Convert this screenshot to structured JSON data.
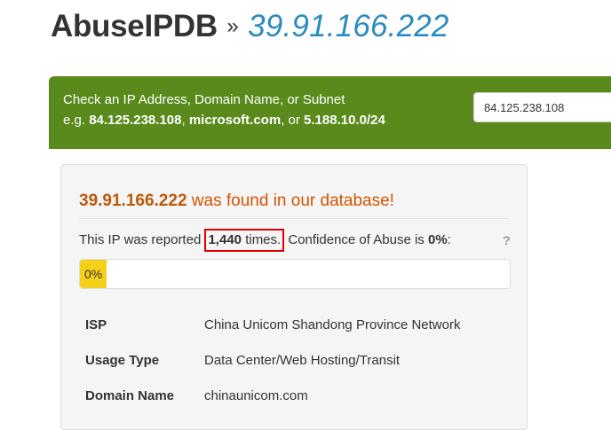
{
  "header": {
    "brand": "AbuseIPDB",
    "separator": "»",
    "ip": "39.91.166.222"
  },
  "search": {
    "prompt": "Check an IP Address, Domain Name, or Subnet",
    "example_prefix": "e.g.",
    "example_ip": "84.125.238.108",
    "example_comma1": ",",
    "example_domain": "microsoft.com",
    "example_or": ", or",
    "example_subnet": "5.188.10.0/24",
    "input_value": "84.125.238.108"
  },
  "result": {
    "ip": "39.91.166.222",
    "found_text": "was found in our database!",
    "report_prefix": "This IP was reported",
    "report_count": "1,440",
    "report_times": "times.",
    "confidence_label": "Confidence of Abuse is",
    "confidence_value": "0%",
    "confidence_suffix": ":",
    "help": "?",
    "progress_percent": 0,
    "progress_label": "0%"
  },
  "details": [
    {
      "label": "ISP",
      "value": "China Unicom Shandong Province Network"
    },
    {
      "label": "Usage Type",
      "value": "Data Center/Web Hosting/Transit"
    },
    {
      "label": "Domain Name",
      "value": "chinaunicom.com"
    }
  ],
  "colors": {
    "brand_ip": "#2a8bbf",
    "search_panel": "#5a8a1c",
    "found_text": "#d35400",
    "progress_fill": "#f4d01b",
    "annotation_box": "#e00000"
  }
}
